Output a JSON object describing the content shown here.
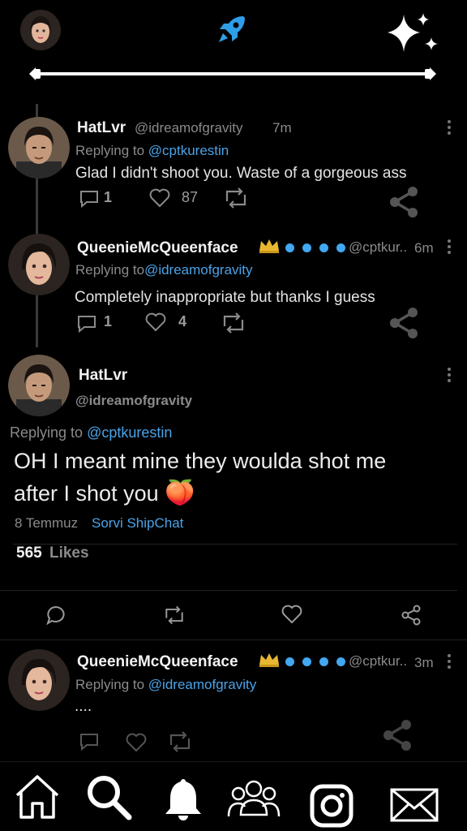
{
  "header": {
    "profile_icon": "user-avatar",
    "logo_icon": "rocket-icon",
    "sparkle_icon": "sparkles-icon"
  },
  "tweets": [
    {
      "name": "HatLvr",
      "handle": "@idreamofgravity",
      "time": "7m",
      "reply_prefix": "Replying to",
      "reply_to": "@cptkurestin",
      "text": "Glad I didn't shoot you. Waste of a gorgeous ass",
      "replies": "1",
      "likes": "87"
    },
    {
      "name": "QueenieMcQueenface",
      "handle": "@cptkur..",
      "time": "6m",
      "reply_prefix": "Replying to",
      "reply_to": "@idreamofgravity",
      "text": "Completely inappropriate but thanks I guess",
      "replies": "1",
      "likes": "4"
    }
  ],
  "focused": {
    "name": "HatLvr",
    "handle": "@idreamofgravity",
    "reply_prefix": "Replying to",
    "reply_to": "@cptkurestin",
    "text": "OH I meant mine they woulda shot me after I shot you",
    "emoji": "🍑",
    "date": "8 Temmuz",
    "source": "Sorvi ShipChat",
    "like_count": "565",
    "like_label": "Likes"
  },
  "reply": {
    "name": "QueenieMcQueenface",
    "handle": "@cptkur..",
    "time": "3m",
    "reply_prefix": "Replying to",
    "reply_to": "@idreamofgravity",
    "text": "...."
  },
  "colors": {
    "accent": "#4aa3e8",
    "crown": "#e8b630",
    "background": "#000000"
  },
  "bottom_nav": [
    "home-icon",
    "search-icon",
    "bell-icon",
    "people-icon",
    "instagram-icon",
    "mail-icon"
  ]
}
